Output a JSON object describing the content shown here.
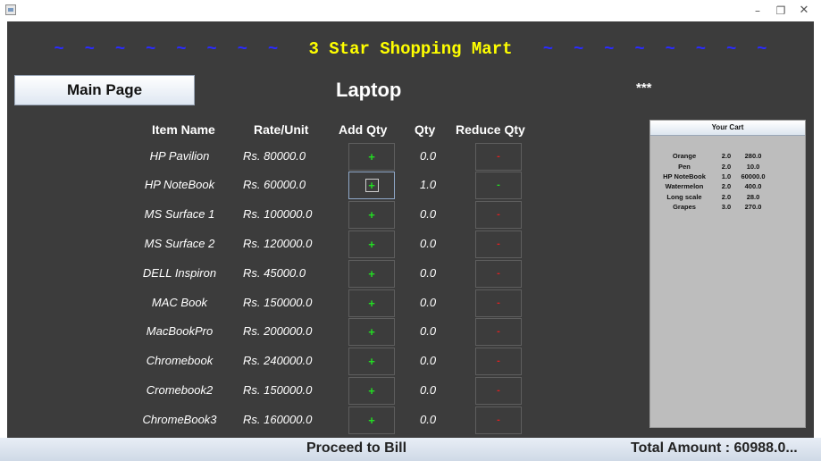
{
  "window": {
    "min_glyph": "–",
    "max_glyph": "❐",
    "close_glyph": "✕"
  },
  "banner": {
    "tildes_left": "~  ~  ~  ~  ~  ~  ~  ~",
    "title": "3 Star Shopping Mart",
    "tildes_right": "~  ~  ~  ~  ~  ~  ~  ~",
    "tilde_color": "#2b2bff",
    "title_color": "#ffff00"
  },
  "main_page_label": "Main Page",
  "category": "Laptop",
  "stars": "***",
  "columns": {
    "item_name": "Item Name",
    "rate": "Rate/Unit",
    "add_qty": "Add Qty",
    "qty": "Qty",
    "reduce_qty": "Reduce Qty"
  },
  "items": [
    {
      "name": "HP Pavilion",
      "rate": "Rs. 80000.0",
      "qty": "0.0",
      "add": "+",
      "reduce": "-"
    },
    {
      "name": "HP NoteBook",
      "rate": "Rs. 60000.0",
      "qty": "1.0",
      "add": "+",
      "reduce": "-"
    },
    {
      "name": "MS Surface 1",
      "rate": "Rs. 100000.0",
      "qty": "0.0",
      "add": "+",
      "reduce": "-"
    },
    {
      "name": "MS Surface 2",
      "rate": "Rs. 120000.0",
      "qty": "0.0",
      "add": "+",
      "reduce": "-"
    },
    {
      "name": "DELL Inspiron",
      "rate": "Rs. 45000.0",
      "qty": "0.0",
      "add": "+",
      "reduce": "-"
    },
    {
      "name": "MAC Book",
      "rate": "Rs. 150000.0",
      "qty": "0.0",
      "add": "+",
      "reduce": "-"
    },
    {
      "name": "MacBookPro",
      "rate": "Rs. 200000.0",
      "qty": "0.0",
      "add": "+",
      "reduce": "-"
    },
    {
      "name": "Chromebook",
      "rate": "Rs. 240000.0",
      "qty": "0.0",
      "add": "+",
      "reduce": "-"
    },
    {
      "name": "Cromebook2",
      "rate": "Rs. 150000.0",
      "qty": "0.0",
      "add": "+",
      "reduce": "-"
    },
    {
      "name": "ChromeBook3",
      "rate": "Rs. 160000.0",
      "qty": "0.0",
      "add": "+",
      "reduce": "-"
    }
  ],
  "cart": {
    "title": "Your Cart",
    "entries": [
      {
        "item": "Orange",
        "qty": "2.0",
        "amount": "280.0"
      },
      {
        "item": "Pen",
        "qty": "2.0",
        "amount": "10.0"
      },
      {
        "item": "HP NoteBook",
        "qty": "1.0",
        "amount": "60000.0"
      },
      {
        "item": "Watermelon",
        "qty": "2.0",
        "amount": "400.0"
      },
      {
        "item": "Long scale",
        "qty": "2.0",
        "amount": "28.0"
      },
      {
        "item": "Grapes",
        "qty": "3.0",
        "amount": "270.0"
      }
    ]
  },
  "proceed_label": "Proceed  to  Bill",
  "total_label": "Total Amount : 60988.0..."
}
